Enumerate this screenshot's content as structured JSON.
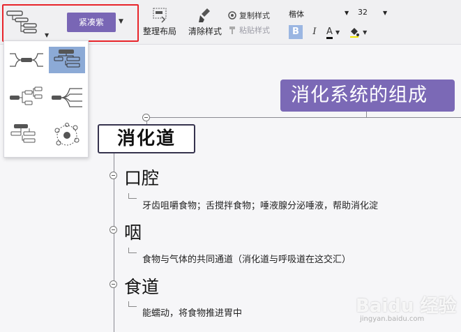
{
  "toolbar": {
    "theme_label": "紧凑紫",
    "organize_label": "整理布局",
    "clear_style_label": "清除样式",
    "copy_style_label": "复制样式",
    "paste_style_label": "粘贴样式",
    "font_family": "楷体",
    "font_size": "32",
    "bold_label": "B",
    "italic_label": "I",
    "font_color_label": "A",
    "accent_color": "#7966b5",
    "highlight_color": "#e8242a"
  },
  "mindmap": {
    "central_topic": "消化系统的组成",
    "main_topic": "消化道",
    "subtopics": [
      {
        "title": "口腔",
        "detail": "牙齿咀嚼食物；舌搅拌食物；唾液腺分泌唾液，帮助消化淀"
      },
      {
        "title": "咽",
        "detail": "食物与气体的共同通道（消化道与呼吸道在这交汇）"
      },
      {
        "title": "食道",
        "detail": "能蠕动，将食物推进胃中"
      }
    ]
  },
  "watermark": {
    "text": "Baidu 经验",
    "sub": "jingyan.baidu.com"
  }
}
